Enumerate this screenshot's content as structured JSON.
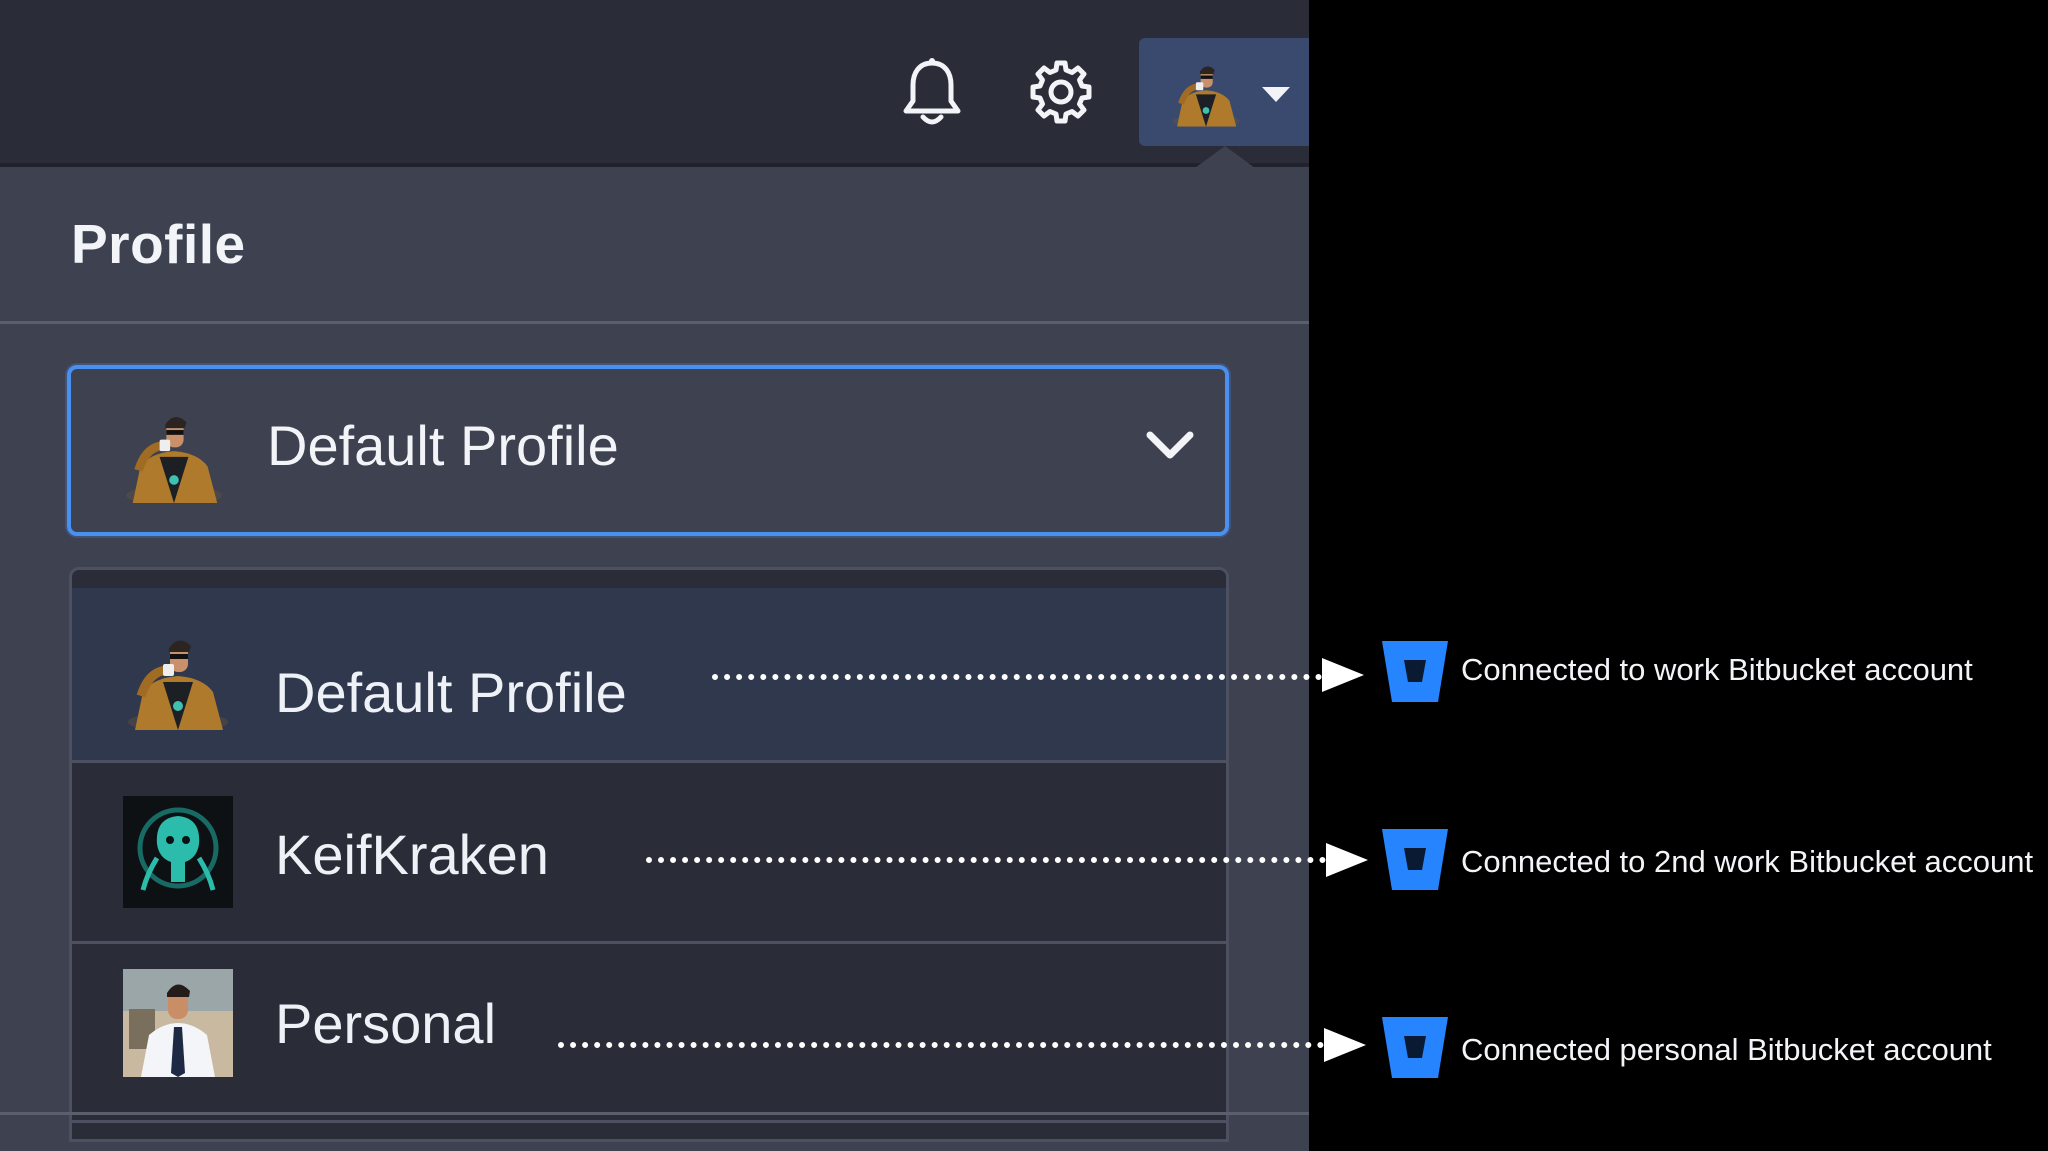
{
  "header": {
    "notifications_icon": "bell-icon",
    "settings_icon": "gear-icon",
    "account_menu_icon": "caret-down-icon"
  },
  "profile": {
    "title": "Profile",
    "selected": "Default Profile",
    "dropdown_icon": "chevron-down-icon",
    "options": [
      {
        "label": "Default Profile",
        "avatar": "man-in-jacket-drinking-avatar",
        "selected": true
      },
      {
        "label": "KeifKraken",
        "avatar": "gitkraken-logo-avatar",
        "selected": false
      },
      {
        "label": "Personal",
        "avatar": "man-in-shirt-and-tie-avatar",
        "selected": false
      }
    ]
  },
  "annotations": [
    {
      "text": "Connected to work Bitbucket account",
      "icon": "bitbucket-icon"
    },
    {
      "text": "Connected to 2nd work Bitbucket account",
      "icon": "bitbucket-icon"
    },
    {
      "text": "Connected personal Bitbucket account",
      "icon": "bitbucket-icon"
    }
  ],
  "colors": {
    "topbar": "#2a2d38",
    "panel": "#3d4150",
    "menu": "#2a2d38",
    "selected_row": "#30384d",
    "focus_border": "#4a90f0",
    "bitbucket_blue": "#2684ff"
  }
}
